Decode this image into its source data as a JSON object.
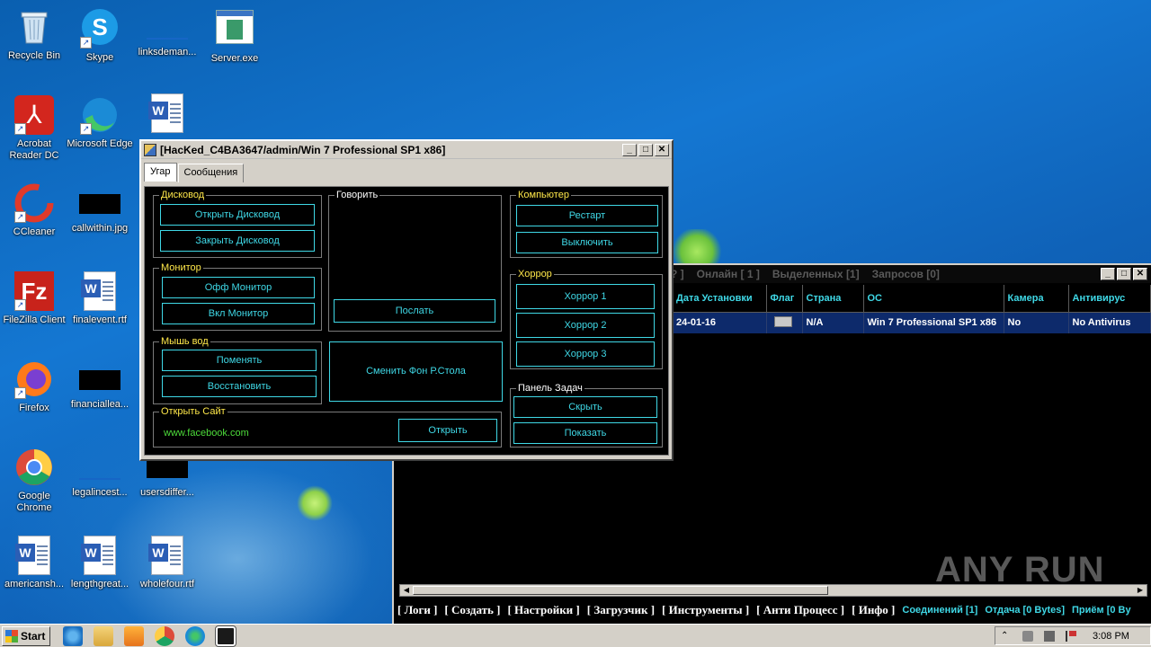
{
  "desktop": {
    "icons": [
      {
        "label": "Recycle Bin"
      },
      {
        "label": "Skype"
      },
      {
        "label": "linksdeman..."
      },
      {
        "label": "Server.exe"
      },
      {
        "label": "Acrobat Reader DC"
      },
      {
        "label": "Microsoft Edge"
      },
      {
        "label": "CCleaner"
      },
      {
        "label": "callwithin.jpg"
      },
      {
        "label": "FileZilla Client"
      },
      {
        "label": "finalevent.rtf"
      },
      {
        "label": "Firefox"
      },
      {
        "label": "financiallea..."
      },
      {
        "label": "Google Chrome"
      },
      {
        "label": "legalincest..."
      },
      {
        "label": "usersdiffer..."
      },
      {
        "label": "americansh..."
      },
      {
        "label": "lengthgreat..."
      },
      {
        "label": "wholefour.rtf"
      }
    ]
  },
  "main_window": {
    "title": "[HacKed_C4BA3647/admin/Win 7 Professional SP1 x86]",
    "tabs": [
      "Угар",
      "Сообщения"
    ],
    "groups": {
      "drive": {
        "legend": "Дисковод",
        "open": "Открыть Дисковод",
        "close": "Закрыть Дисковод"
      },
      "speak": {
        "legend": "Говорить",
        "send": "Послать"
      },
      "computer": {
        "legend": "Компьютер",
        "restart": "Рестарт",
        "shutdown": "Выключить"
      },
      "monitor": {
        "legend": "Монитор",
        "off": "Офф Монитор",
        "on": "Вкл Монитор"
      },
      "horror": {
        "legend": "Хоррор",
        "h1": "Хоррор 1",
        "h2": "Хоррор 2",
        "h3": "Хоррор 3"
      },
      "mouse": {
        "legend": "Мышь вод",
        "swap": "Поменять",
        "restore": "Восстановить"
      },
      "wallpaper": {
        "label": "Сменить Фон Р.Стола"
      },
      "taskbar": {
        "legend": "Панель Задач",
        "hide": "Скрыть",
        "show": "Показать"
      },
      "site": {
        "legend": "Открыть Сайт",
        "url": "www.facebook.com",
        "open": "Открыть"
      }
    }
  },
  "server_window": {
    "status": {
      "fragment": "? ]",
      "online": "Онлайн [ 1 ]",
      "selected": "Выделенных [1]",
      "requests": "Запросов [0]"
    },
    "columns": [
      "Дата Установки",
      "Флаг",
      "Страна",
      "ОС",
      "Камера",
      "Антивирус"
    ],
    "rows": [
      {
        "date": "24-01-16",
        "country": "N/A",
        "os": "Win 7 Professional SP1 x86",
        "camera": "No",
        "antivirus": "No Antivirus"
      }
    ],
    "menu": [
      "[ Логи ]",
      "[ Создать ]",
      "[ Настройки ]",
      "[ Загрузчик ]",
      "[ Инструменты ]",
      "[ Анти Процесс ]",
      "[ Инфо ]"
    ],
    "stats": {
      "connections": "Соединений [1]",
      "upload": "Отдача [0 Bytes]",
      "download": "Приём [0 By"
    }
  },
  "taskbar": {
    "start_label": "Start",
    "clock": "3:08 PM"
  },
  "watermark": "ANY RUN"
}
